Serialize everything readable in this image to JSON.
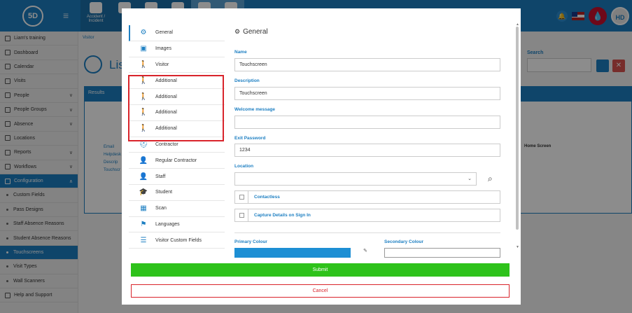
{
  "app": {
    "logo_text": "5D",
    "top_nav": [
      {
        "label": "Accident / Incident"
      },
      {
        "label": ""
      },
      {
        "label": ""
      },
      {
        "label": ""
      },
      {
        "label": ""
      },
      {
        "label": ""
      }
    ],
    "user_initials": "HD"
  },
  "sidebar": {
    "items": [
      {
        "label": "Liam's training",
        "chevron": ""
      },
      {
        "label": "Dashboard",
        "chevron": ""
      },
      {
        "label": "Calendar",
        "chevron": ""
      },
      {
        "label": "Visits",
        "chevron": ""
      },
      {
        "label": "People",
        "chevron": "∨"
      },
      {
        "label": "People Groups",
        "chevron": "∨"
      },
      {
        "label": "Absence",
        "chevron": "∨"
      },
      {
        "label": "Locations",
        "chevron": ""
      },
      {
        "label": "Reports",
        "chevron": "∨"
      },
      {
        "label": "Workflows",
        "chevron": "∨"
      },
      {
        "label": "Configuration",
        "chevron": "∧"
      },
      {
        "label": "Custom Fields",
        "chevron": ""
      },
      {
        "label": "Pass Designs",
        "chevron": ""
      },
      {
        "label": "Staff Absence Reasons",
        "chevron": ""
      },
      {
        "label": "Student Absence Reasons",
        "chevron": ""
      },
      {
        "label": "Touchscreens",
        "chevron": ""
      },
      {
        "label": "Visit Types",
        "chevron": ""
      },
      {
        "label": "Wall Scanners",
        "chevron": ""
      },
      {
        "label": "Help and Support",
        "chevron": ""
      }
    ]
  },
  "background": {
    "breadcrumb": "Visitor",
    "page_title": "Lis",
    "search_label": "Search",
    "results_label": "Results",
    "home_screen_label": "Home Screen",
    "left_labels": [
      "Email",
      "Helpdesk",
      "Descrip",
      "Touchscr"
    ]
  },
  "modal": {
    "tabs": [
      {
        "label": "General",
        "icon": "gears-icon",
        "glyph": "⚙"
      },
      {
        "label": "Images",
        "icon": "image-icon",
        "glyph": "▣"
      },
      {
        "label": "Visitor",
        "icon": "walking-icon",
        "glyph": "🚶"
      },
      {
        "label": "Additional",
        "icon": "walking-icon",
        "glyph": "🚶"
      },
      {
        "label": "Additional",
        "icon": "walking-icon",
        "glyph": "🚶"
      },
      {
        "label": "Additional",
        "icon": "walking-icon",
        "glyph": "🚶"
      },
      {
        "label": "Additional",
        "icon": "walking-icon",
        "glyph": "🚶"
      },
      {
        "label": "Contractor",
        "icon": "hard-hat-icon",
        "glyph": "⛑"
      },
      {
        "label": "Regular Contractor",
        "icon": "user-cog-icon",
        "glyph": "👤"
      },
      {
        "label": "Staff",
        "icon": "user-tie-icon",
        "glyph": "👤"
      },
      {
        "label": "Student",
        "icon": "graduate-icon",
        "glyph": "🎓"
      },
      {
        "label": "Scan",
        "icon": "qrcode-icon",
        "glyph": "▦"
      },
      {
        "label": "Languages",
        "icon": "flag-icon",
        "glyph": "⚑"
      },
      {
        "label": "Visitor Custom Fields",
        "icon": "list-check-icon",
        "glyph": "☰"
      }
    ],
    "section_title": "General",
    "fields": {
      "name": {
        "label": "Name",
        "value": "Touchscreen"
      },
      "description": {
        "label": "Description",
        "value": "Touchscreen"
      },
      "welcome": {
        "label": "Welcome message",
        "value": ""
      },
      "exit_password": {
        "label": "Exit Password",
        "value": "1234"
      },
      "location": {
        "label": "Location",
        "value": ""
      }
    },
    "checkboxes": [
      {
        "label": "Contactless"
      },
      {
        "label": "Capture Details on Sign In"
      }
    ],
    "primary_colour_label": "Primary Colour",
    "secondary_colour_label": "Secondary Colour",
    "primary_colour": "#1d8fd4",
    "submit_label": "Submit",
    "cancel_label": "Cancel"
  },
  "colors": {
    "brand": "#1d7fc2",
    "submit": "#2ec21b",
    "danger": "#d9242b"
  }
}
